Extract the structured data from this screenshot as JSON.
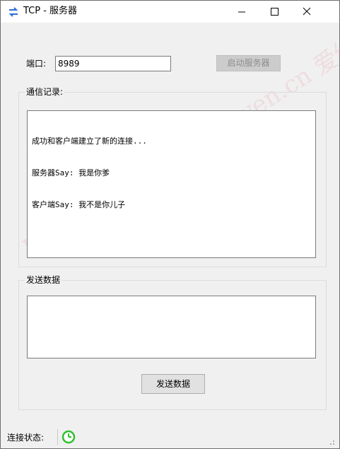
{
  "window": {
    "title": "TCP - 服务器",
    "icon": "network-transfer-icon",
    "controls": [
      "minimize-icon",
      "maximize-icon",
      "close-icon"
    ]
  },
  "server": {
    "port_label": "端口:",
    "port_value": "8989",
    "start_button": "启动服务器",
    "start_button_enabled": false
  },
  "log": {
    "group_label": "通信记录:",
    "lines": [
      "成功和客户端建立了新的连接...",
      "服务器Say: 我是你爹",
      "客户端Say: 我不是你儿子"
    ]
  },
  "send": {
    "group_label": "发送数据",
    "input_value": "",
    "button": "发送数据"
  },
  "status": {
    "label": "连接状态:",
    "icon": "connected-status-icon",
    "icon_color": "#2fbf2f"
  },
  "watermark": "Programmer Subingwen.cn 爱编程的大丙",
  "colors": {
    "window_bg": "#f0f0f0",
    "titlebar_bg": "#ffffff",
    "border": "#7a7a7a"
  }
}
